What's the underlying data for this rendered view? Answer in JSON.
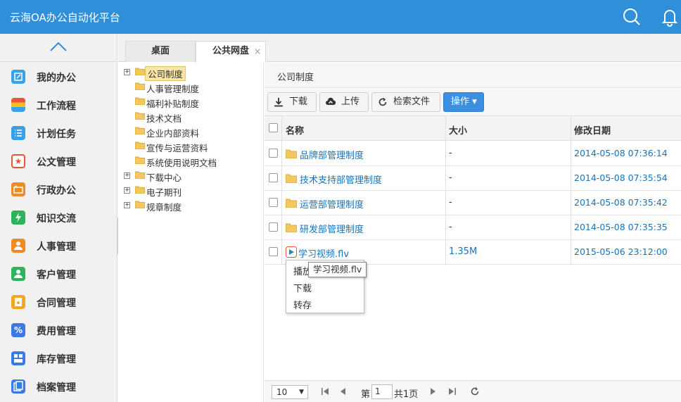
{
  "header": {
    "title": "云海OA办公自动化平台",
    "bg_color": "#2f8fd8"
  },
  "sidebar": {
    "items": [
      {
        "label": "我的办公",
        "icon": "edit-square-icon",
        "color": "#3aa0e8"
      },
      {
        "label": "工作流程",
        "icon": "workflow-icon",
        "color": "#e8553a"
      },
      {
        "label": "计划任务",
        "icon": "list-icon",
        "color": "#3aa0e8"
      },
      {
        "label": "公文管理",
        "icon": "star-doc-icon",
        "color": "#e8553a"
      },
      {
        "label": "行政办公",
        "icon": "folder-open-icon",
        "color": "#f08a24"
      },
      {
        "label": "知识交流",
        "icon": "knowledge-icon",
        "color": "#2fb35a"
      },
      {
        "label": "人事管理",
        "icon": "person-icon",
        "color": "#f08a24"
      },
      {
        "label": "客户管理",
        "icon": "customer-icon",
        "color": "#2fb35a"
      },
      {
        "label": "合同管理",
        "icon": "contract-icon",
        "color": "#f0a824"
      },
      {
        "label": "费用管理",
        "icon": "percent-icon",
        "color": "#3a7ae8"
      },
      {
        "label": "库存管理",
        "icon": "inventory-icon",
        "color": "#3a7ae8"
      },
      {
        "label": "档案管理",
        "icon": "archive-icon",
        "color": "#3a7ae8"
      }
    ]
  },
  "tabs": [
    {
      "label": "桌面"
    },
    {
      "label": "公共网盘",
      "close": "×"
    }
  ],
  "tree": {
    "nodes": [
      {
        "label": "公司制度",
        "expander": "+",
        "level": 0,
        "selected": true
      },
      {
        "label": "人事管理制度",
        "level": 1
      },
      {
        "label": "福利补贴制度",
        "level": 1
      },
      {
        "label": "技术文档",
        "level": 1
      },
      {
        "label": "企业内部资料",
        "level": 1
      },
      {
        "label": "宣传与运营资料",
        "level": 1
      },
      {
        "label": "系统使用说明文档",
        "level": 1
      },
      {
        "label": "下载中心",
        "expander": "+",
        "level": 0
      },
      {
        "label": "电子期刊",
        "expander": "+",
        "level": 0
      },
      {
        "label": "规章制度",
        "expander": "+",
        "level": 0
      }
    ]
  },
  "main": {
    "breadcrumb": "公司制度",
    "toolbar": {
      "download": "下载",
      "upload": "上传",
      "search": "检索文件",
      "operate": "操作"
    },
    "columns": {
      "name": "名称",
      "size": "大小",
      "date": "修改日期"
    },
    "rows": [
      {
        "name": "品牌部管理制度",
        "size": "-",
        "date": "2014-05-08 07:36:14",
        "type": "folder"
      },
      {
        "name": "技术支持部管理制度",
        "size": "-",
        "date": "2014-05-08 07:35:54",
        "type": "folder"
      },
      {
        "name": "运营部管理制度",
        "size": "-",
        "date": "2014-05-08 07:35:42",
        "type": "folder"
      },
      {
        "name": "研发部管理制度",
        "size": "-",
        "date": "2014-05-08 07:35:35",
        "type": "folder"
      },
      {
        "name": "学习视频.flv",
        "size": "1.35M",
        "date": "2015-05-06 23:12:00",
        "type": "video"
      }
    ],
    "context_menu": [
      "播放",
      "下载",
      "转存"
    ],
    "tooltip": "学习视频.flv"
  },
  "pager": {
    "page_size": "10",
    "page_prefix": "第",
    "page": "1",
    "page_total": "共1页"
  }
}
